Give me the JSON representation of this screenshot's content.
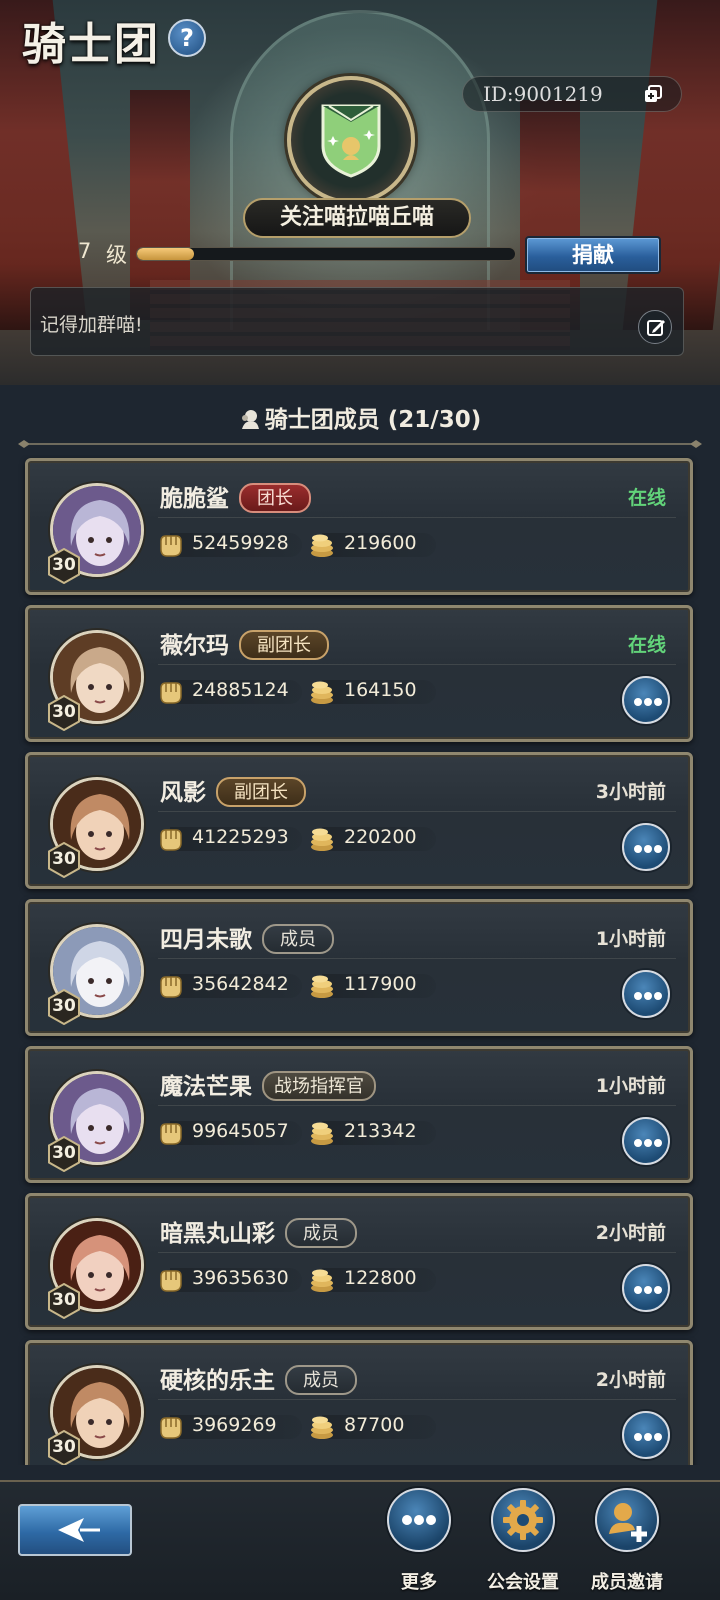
{
  "header": {
    "title": "骑士团",
    "help_label": "?",
    "id_label": "ID:9001219",
    "guild_name": "关注喵拉喵丘喵",
    "level_number": "7",
    "level_unit": "级",
    "level_progress": 0.15,
    "donate_label": "捐献",
    "notice_text": "记得加群喵!"
  },
  "members_section": {
    "title": "骑士团成员 (21/30)",
    "members": [
      {
        "name": "脆脆鲨",
        "role": "团长",
        "role_type": "leader",
        "status": "在线",
        "status_online": true,
        "level": "30",
        "power": "52459928",
        "contribution": "219600",
        "has_more_button": false
      },
      {
        "name": "薇尔玛",
        "role": "副团长",
        "role_type": "vice",
        "status": "在线",
        "status_online": true,
        "level": "30",
        "power": "24885124",
        "contribution": "164150",
        "has_more_button": true
      },
      {
        "name": "风影",
        "role": "副团长",
        "role_type": "vice",
        "status": "3小时前",
        "status_online": false,
        "level": "30",
        "power": "41225293",
        "contribution": "220200",
        "has_more_button": true
      },
      {
        "name": "四月未歌",
        "role": "成员",
        "role_type": "member",
        "status": "1小时前",
        "status_online": false,
        "level": "30",
        "power": "35642842",
        "contribution": "117900",
        "has_more_button": true
      },
      {
        "name": "魔法芒果",
        "role": "战场指挥官",
        "role_type": "cmdr",
        "status": "1小时前",
        "status_online": false,
        "level": "30",
        "power": "99645057",
        "contribution": "213342",
        "has_more_button": true
      },
      {
        "name": "暗黑丸山彩",
        "role": "成员",
        "role_type": "member",
        "status": "2小时前",
        "status_online": false,
        "level": "30",
        "power": "39635630",
        "contribution": "122800",
        "has_more_button": true
      },
      {
        "name": "硬核的乐主",
        "role": "成员",
        "role_type": "member",
        "status": "2小时前",
        "status_online": false,
        "level": "30",
        "power": "3969269",
        "contribution": "87700",
        "has_more_button": true
      }
    ]
  },
  "bottom_nav": {
    "more_label": "更多",
    "settings_label": "公会设置",
    "invite_label": "成员邀请"
  },
  "icons": {
    "help": "question-icon",
    "copy": "copy-icon",
    "emblem": "shield-emblem-icon",
    "edit": "edit-icon",
    "member": "member-icon",
    "power": "fist-icon",
    "contribution": "coins-icon",
    "more": "ellipsis-icon",
    "back": "back-arrow-icon",
    "settings": "gear-icon",
    "invite": "add-user-icon"
  },
  "colors": {
    "online": "#62d37a",
    "level_fill": "#e2ac55",
    "accent_blue": "#2e6aa6",
    "leader_tag": "#9a2d2d",
    "gold_border": "#c8b78a"
  }
}
